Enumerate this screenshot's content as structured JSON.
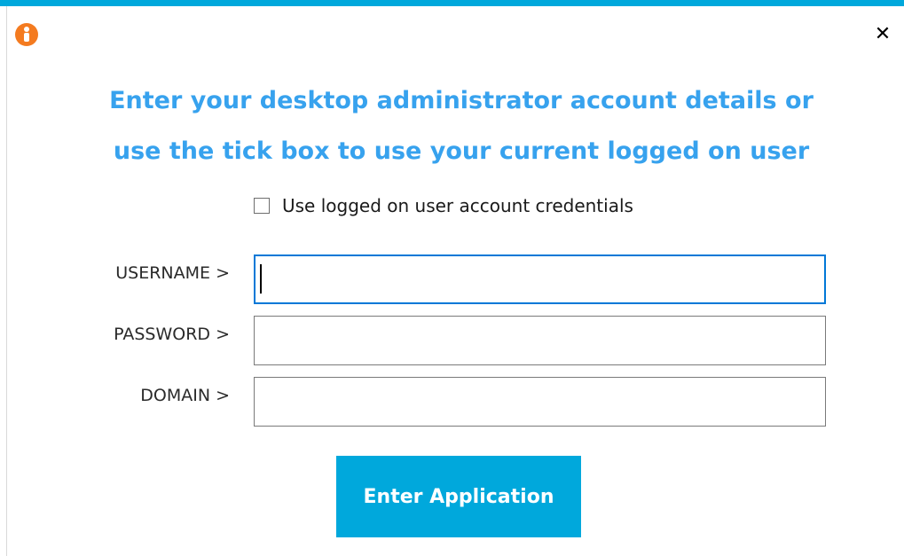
{
  "colors": {
    "accent": "#00a8dc",
    "heading": "#37a2ee",
    "app_icon": "#f47b20",
    "focus_border": "#0078d7"
  },
  "icons": {
    "app": "info-person-icon",
    "close": "close-icon"
  },
  "window": {
    "close_glyph": "✕"
  },
  "heading": {
    "line1": "Enter your desktop administrator account details or",
    "line2": "use the tick box to use your current logged on user"
  },
  "remember": {
    "label": "Use logged on user account credentials",
    "checked": false
  },
  "fields": {
    "username": {
      "label": "USERNAME >",
      "value": ""
    },
    "password": {
      "label": "PASSWORD >",
      "value": ""
    },
    "domain": {
      "label": "DOMAIN >",
      "value": ""
    }
  },
  "actions": {
    "enter_label": "Enter Application"
  }
}
